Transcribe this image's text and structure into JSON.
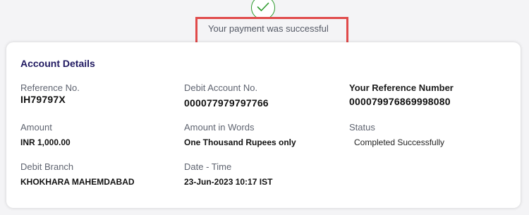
{
  "status_banner": {
    "message": "Your payment was successful",
    "icon": "check-circle-icon",
    "icon_color": "#2e9b2e",
    "highlight_color": "#e04a4a"
  },
  "account_details": {
    "title": "Account Details",
    "title_color": "#1f1860",
    "fields": {
      "reference_no": {
        "label": "Reference No.",
        "value": "IH79797X"
      },
      "debit_account_no": {
        "label": "Debit Account No.",
        "value": "000077979797766"
      },
      "your_reference_number": {
        "label": "Your Reference Number",
        "value": "000079976869998080"
      },
      "amount": {
        "label": "Amount",
        "value": "INR  1,000.00"
      },
      "amount_in_words": {
        "label": "Amount in Words",
        "value": "One Thousand Rupees only"
      },
      "status": {
        "label": "Status",
        "value": "Completed Successfully"
      },
      "debit_branch": {
        "label": "Debit Branch",
        "value": "KHOKHARA MAHEMDABAD"
      },
      "date_time": {
        "label": "Date - Time",
        "value": "23-Jun-2023 10:17 IST"
      }
    }
  }
}
